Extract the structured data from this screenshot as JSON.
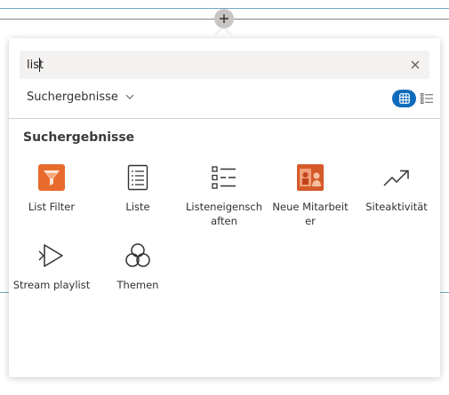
{
  "search": {
    "value": "list",
    "clear_icon": "close-icon"
  },
  "filter": {
    "label": "Suchergebnisse",
    "icon": "chevron-down-icon"
  },
  "view": {
    "grid_icon": "grid-view-icon",
    "list_icon": "list-view-icon",
    "accent": "#0f6cbd"
  },
  "section": {
    "title": "Suchergebnisse"
  },
  "results": [
    {
      "label": "List Filter",
      "icon": "funnel-icon"
    },
    {
      "label": "Liste",
      "icon": "list-document-icon"
    },
    {
      "label": "Listeneigenschaften",
      "icon": "list-properties-icon"
    },
    {
      "label": "Neue Mitarbeiter",
      "icon": "new-employees-icon"
    },
    {
      "label": "Siteaktivität",
      "icon": "trend-arrow-icon"
    },
    {
      "label": "Stream playlist",
      "icon": "stream-play-icon"
    },
    {
      "label": "Themen",
      "icon": "topics-icon"
    }
  ]
}
